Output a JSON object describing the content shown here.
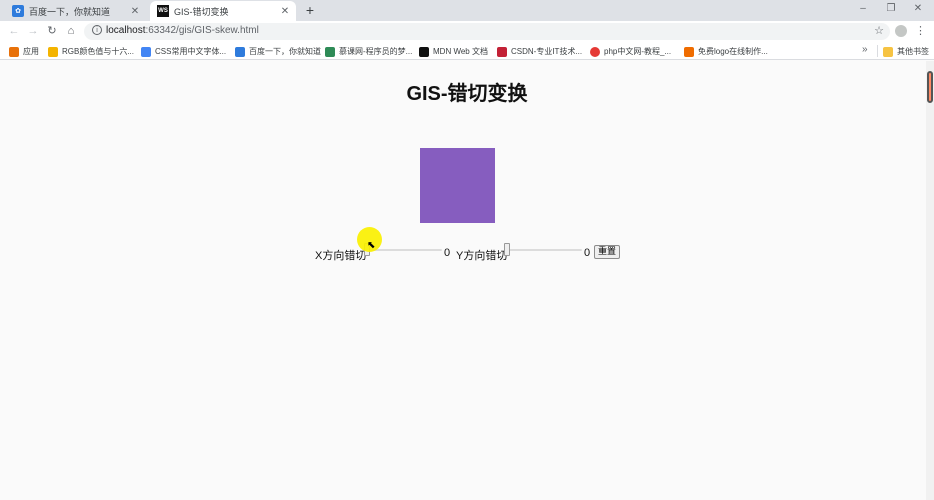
{
  "browser": {
    "tabs": [
      {
        "title": "百度一下，你就知道",
        "active": false,
        "icon": "baidu-paw-icon"
      },
      {
        "title": "GIS-错切变换",
        "active": true,
        "icon": "webstorm-icon"
      }
    ],
    "url_host": "localhost",
    "url_path": ":63342/gis/GIS-skew.html",
    "bookmarks": [
      {
        "label": "应用",
        "icon": "apps-grid-icon",
        "color": "#e8710a"
      },
      {
        "label": "RGB颜色值与十六...",
        "icon": "rainbow-icon",
        "color": "#f4b400"
      },
      {
        "label": "CSS常用中文字体...",
        "icon": "page-icon",
        "color": "#4285f4"
      },
      {
        "label": "百度一下，你就知道",
        "icon": "baidu-paw-icon",
        "color": "#2e7bdc"
      },
      {
        "label": "慕课网-程序员的梦...",
        "icon": "book-icon",
        "color": "#2e8b57"
      },
      {
        "label": "MDN Web 文档",
        "icon": "mdn-icon",
        "color": "#111111"
      },
      {
        "label": "CSDN-专业IT技术...",
        "icon": "csdn-icon",
        "color": "#c32136"
      },
      {
        "label": "php中文网-教程_...",
        "icon": "php-icon",
        "color": "#e53935"
      },
      {
        "label": "免费logo在线制作...",
        "icon": "logo-maker-icon",
        "color": "#ef6c00"
      }
    ],
    "other_bookmarks": "其他书签"
  },
  "page": {
    "title": "GIS-错切变换",
    "shape_color": "#865dbf",
    "x_label": "X方向错切",
    "x_value": "0",
    "y_label": "Y方向错切",
    "y_value": "0",
    "reset_label": "重置"
  }
}
